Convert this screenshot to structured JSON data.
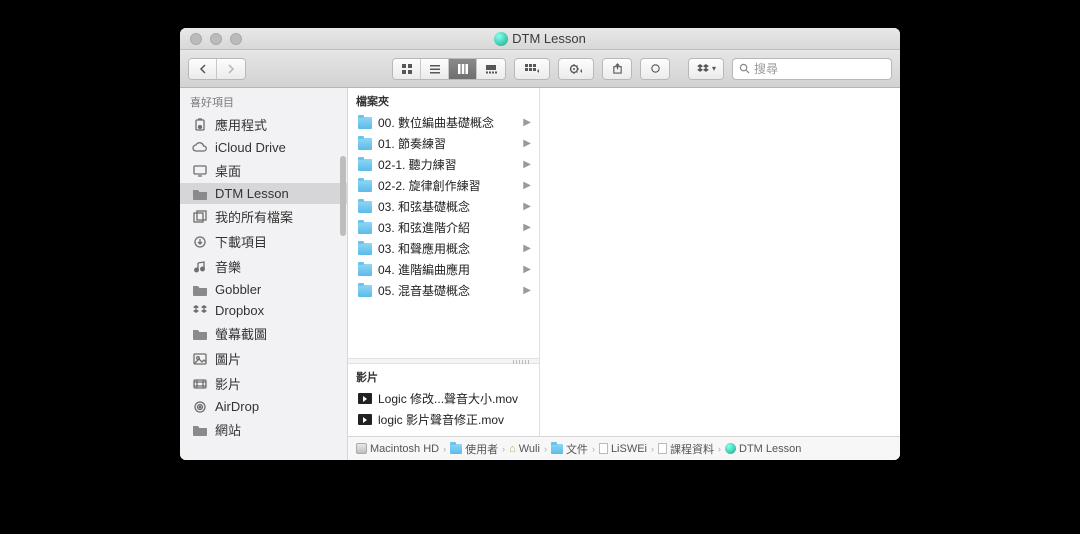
{
  "window": {
    "title": "DTM Lesson"
  },
  "toolbar": {
    "search_placeholder": "搜尋"
  },
  "sidebar": {
    "header": "喜好項目",
    "items": [
      {
        "label": "應用程式",
        "icon": "apps"
      },
      {
        "label": "iCloud Drive",
        "icon": "cloud"
      },
      {
        "label": "桌面",
        "icon": "desktop"
      },
      {
        "label": "DTM Lesson",
        "icon": "folder",
        "selected": true
      },
      {
        "label": "我的所有檔案",
        "icon": "allfiles"
      },
      {
        "label": "下載項目",
        "icon": "download"
      },
      {
        "label": "音樂",
        "icon": "music"
      },
      {
        "label": "Gobbler",
        "icon": "folder"
      },
      {
        "label": "Dropbox",
        "icon": "dropbox"
      },
      {
        "label": "螢幕截圖",
        "icon": "folder"
      },
      {
        "label": "圖片",
        "icon": "photos"
      },
      {
        "label": "影片",
        "icon": "movies"
      },
      {
        "label": "AirDrop",
        "icon": "airdrop"
      },
      {
        "label": "網站",
        "icon": "folder"
      }
    ]
  },
  "column": {
    "section_folders": "檔案夾",
    "section_videos": "影片",
    "folders": [
      "00. 數位編曲基礎概念",
      "01. 節奏練習",
      "02-1. 聽力練習",
      "02-2. 旋律創作練習",
      "03. 和弦基礎概念",
      "03. 和弦進階介紹",
      "03. 和聲應用概念",
      "04. 進階編曲應用",
      "05. 混音基礎概念"
    ],
    "videos": [
      "Logic 修改...聲音大小.mov",
      "logic 影片聲音修正.mov"
    ]
  },
  "path": [
    {
      "label": "Macintosh HD",
      "icon": "hd"
    },
    {
      "label": "使用者",
      "icon": "folder"
    },
    {
      "label": "Wuli",
      "icon": "home"
    },
    {
      "label": "文件",
      "icon": "folder"
    },
    {
      "label": "LiSWEi",
      "icon": "doc"
    },
    {
      "label": "課程資料",
      "icon": "doc"
    },
    {
      "label": "DTM Lesson",
      "icon": "globe"
    }
  ]
}
